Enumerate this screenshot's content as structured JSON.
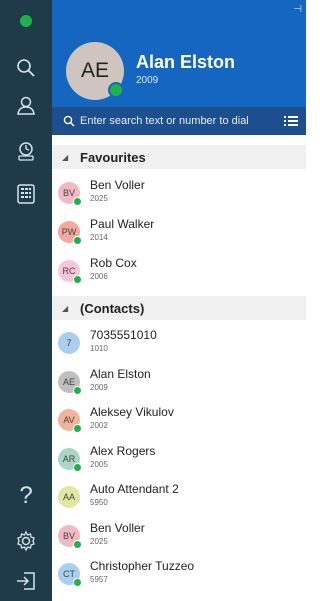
{
  "rail": {
    "icons": [
      "search-icon",
      "contacts-icon",
      "call-history-icon",
      "dialpad-icon",
      "help-icon",
      "settings-icon",
      "sign-out-icon"
    ],
    "help_label": "?"
  },
  "me": {
    "initials": "AE",
    "name": "Alan Elston",
    "ext": "2009"
  },
  "search": {
    "placeholder": "Enter search text or number to dial"
  },
  "sections": {
    "favourites": "Favourites",
    "contacts": "(Contacts)"
  },
  "favourites": [
    {
      "initials": "BV",
      "name": "Ben Voller",
      "ext": "2025",
      "color": "#f0b9c3"
    },
    {
      "initials": "PW",
      "name": "Paul Walker",
      "ext": "2014",
      "color": "#f3a9a0"
    },
    {
      "initials": "RC",
      "name": "Rob Cox",
      "ext": "2006",
      "color": "#f7c6db"
    }
  ],
  "contacts": [
    {
      "initials": "7",
      "name": "7035551010",
      "ext": "1010",
      "color": "#a8cfee",
      "presence": false
    },
    {
      "initials": "AE",
      "name": "Alan Elston",
      "ext": "2009",
      "color": "#bfbfbf",
      "presence": true
    },
    {
      "initials": "AV",
      "name": "Aleksey Vikulov",
      "ext": "2002",
      "color": "#f3b39b",
      "presence": true
    },
    {
      "initials": "AR",
      "name": "Alex Rogers",
      "ext": "2005",
      "color": "#a9d7c6",
      "presence": true
    },
    {
      "initials": "AA",
      "name": "Auto Attendant 2",
      "ext": "5950",
      "color": "#dfe8a1",
      "presence": false
    },
    {
      "initials": "BV",
      "name": "Ben Voller",
      "ext": "2025",
      "color": "#f0b9c3",
      "presence": true
    },
    {
      "initials": "CT",
      "name": "Christopher Tuzzeo",
      "ext": "5957",
      "color": "#a8cfee",
      "presence": true
    }
  ],
  "colors": {
    "rail": "#1f3b4a",
    "header": "#1566c0",
    "search_bar": "#1d4e8d",
    "presence": "#1db34a"
  }
}
